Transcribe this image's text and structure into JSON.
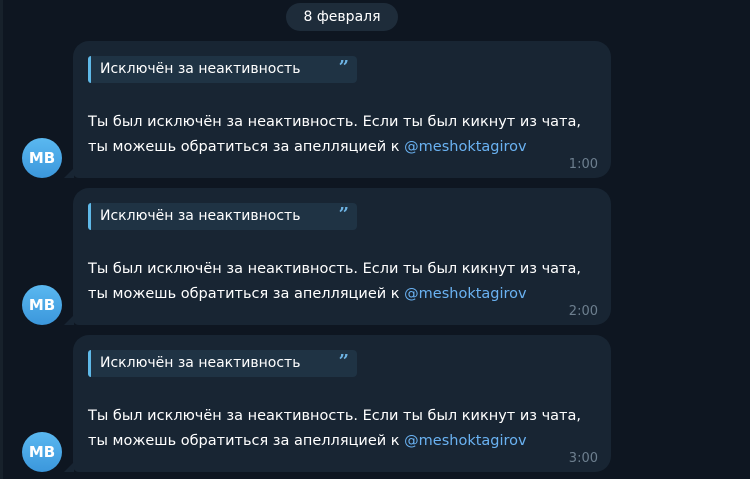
{
  "date_separator": "8 февраля",
  "messages": [
    {
      "avatar_initials": "MB",
      "quote_title": "Исключён за неактивность",
      "quote_icon": "”",
      "text_before_link": "Ты был исключён за неактивность. Если ты был кикнут из чата, ты можешь обратиться за апелляцией к ",
      "link_text": "@meshoktagirov",
      "time": "1:00"
    },
    {
      "avatar_initials": "MB",
      "quote_title": "Исключён за неактивность",
      "quote_icon": "”",
      "text_before_link": "Ты был исключён за неактивность. Если ты был кикнут из чата, ты можешь обратиться за апелляцией к ",
      "link_text": "@meshoktagirov",
      "time": "2:00"
    },
    {
      "avatar_initials": "MB",
      "quote_title": "Исключён за неактивность",
      "quote_icon": "”",
      "text_before_link": "Ты был исключён за неактивность. Если ты был кикнут из чата, ты можешь обратиться за апелляцией к ",
      "link_text": "@meshoktagirov",
      "time": "3:00"
    }
  ],
  "colors": {
    "background": "#0e1621",
    "bubble": "#182533",
    "link": "#6ab2f2",
    "quote_accent": "#5fb9e8"
  }
}
